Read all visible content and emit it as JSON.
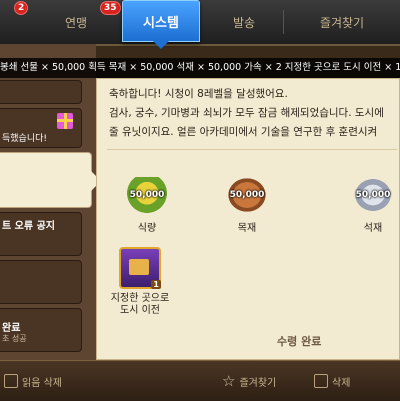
{
  "tabs": [
    {
      "label": "",
      "badge": "2"
    },
    {
      "label": "연맹",
      "badge": "35"
    },
    {
      "label": "시스템",
      "active": true
    },
    {
      "label": "발송"
    },
    {
      "label": "즐겨찾기"
    }
  ],
  "ticker": "봉쇄 선물 × 50,000 획득  목재 × 50,000  석재 × 50,000  가속 × 2  지정한 곳으로 도시 이전 × 1",
  "left_list": [
    {
      "title": ""
    },
    {
      "title": "득했습니다!"
    },
    {
      "title": ""
    },
    {
      "title": "트 오류 공지"
    },
    {
      "title": ""
    },
    {
      "title": "완료",
      "sub": "초 성공"
    }
  ],
  "message": {
    "line1": "축하합니다! 시청이 8레벨을 달성했어요.",
    "line2": "검사, 궁수, 기마병과 쇠뇌가 모두 잠금 해제되었습니다. 도시에",
    "line3": "줄 유닛이지요. 얼른 아카데미에서 기술을 연구한 후 훈련시켜"
  },
  "rewards": [
    {
      "name": "식량",
      "amount": "50,000",
      "icon": "corn-icon"
    },
    {
      "name": "목재",
      "amount": "50,000",
      "icon": "wood-icon"
    },
    {
      "name": "석재",
      "amount": "50,000",
      "icon": "stone-icon"
    },
    {
      "name": "지정한 곳으로 도시 이전",
      "amount": "1",
      "icon": "relocate-icon"
    }
  ],
  "claimed_label": "수령 완료",
  "bottom": {
    "read_delete": "읽음 삭제",
    "favorite": "즐겨찾기",
    "delete": "삭제"
  },
  "colors": {
    "active_tab": "#1d6fd1",
    "panel_bg": "#f3ead2",
    "badge": "#d8241f"
  }
}
